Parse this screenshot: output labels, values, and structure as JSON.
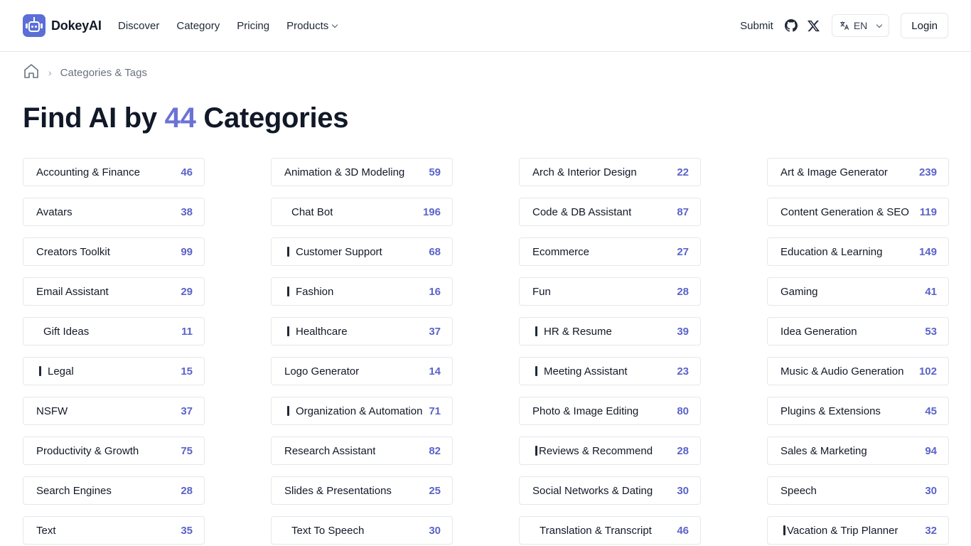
{
  "brand": {
    "name": "DokeyAI"
  },
  "nav": [
    {
      "label": "Discover"
    },
    {
      "label": "Category"
    },
    {
      "label": "Pricing"
    },
    {
      "label": "Products"
    }
  ],
  "header_right": {
    "submit": "Submit",
    "language": "EN",
    "login": "Login"
  },
  "breadcrumb": {
    "current": "Categories & Tags"
  },
  "title": {
    "prefix": "Find AI by",
    "count": "44",
    "suffix": "Categories"
  },
  "colors": {
    "accent": "#5b63c9",
    "brand": "#5b6fd6"
  },
  "categories": [
    {
      "name": "Accounting & Finance",
      "count": "46",
      "prefix": ""
    },
    {
      "name": "Animation & 3D Modeling",
      "count": "59",
      "prefix": ""
    },
    {
      "name": "Arch & Interior Design",
      "count": "22",
      "prefix": ""
    },
    {
      "name": "Art & Image Generator",
      "count": "239",
      "prefix": ""
    },
    {
      "name": "Avatars",
      "count": "38",
      "prefix": ""
    },
    {
      "name": "Chat Bot",
      "count": "196",
      "prefix": "space"
    },
    {
      "name": "Code & DB Assistant",
      "count": "87",
      "prefix": ""
    },
    {
      "name": "Content Generation & SEO",
      "count": "119",
      "prefix": ""
    },
    {
      "name": "Creators Toolkit",
      "count": "99",
      "prefix": ""
    },
    {
      "name": "Customer Support",
      "count": "68",
      "prefix": "emoji"
    },
    {
      "name": "Ecommerce",
      "count": "27",
      "prefix": ""
    },
    {
      "name": "Education & Learning",
      "count": "149",
      "prefix": ""
    },
    {
      "name": "Email Assistant",
      "count": "29",
      "prefix": ""
    },
    {
      "name": "Fashion",
      "count": "16",
      "prefix": "emoji"
    },
    {
      "name": "Fun",
      "count": "28",
      "prefix": ""
    },
    {
      "name": "Gaming",
      "count": "41",
      "prefix": ""
    },
    {
      "name": "Gift Ideas",
      "count": "11",
      "prefix": "space"
    },
    {
      "name": "Healthcare",
      "count": "37",
      "prefix": "emoji"
    },
    {
      "name": "HR & Resume",
      "count": "39",
      "prefix": "emoji"
    },
    {
      "name": "Idea Generation",
      "count": "53",
      "prefix": ""
    },
    {
      "name": "Legal",
      "count": "15",
      "prefix": "emoji"
    },
    {
      "name": "Logo Generator",
      "count": "14",
      "prefix": ""
    },
    {
      "name": "Meeting Assistant",
      "count": "23",
      "prefix": "emoji"
    },
    {
      "name": "Music & Audio Generation",
      "count": "102",
      "prefix": ""
    },
    {
      "name": "NSFW",
      "count": "37",
      "prefix": ""
    },
    {
      "name": "Organization & Automation",
      "count": "71",
      "prefix": "emoji"
    },
    {
      "name": "Photo & Image Editing",
      "count": "80",
      "prefix": ""
    },
    {
      "name": "Plugins & Extensions",
      "count": "45",
      "prefix": ""
    },
    {
      "name": "Productivity & Growth",
      "count": "75",
      "prefix": ""
    },
    {
      "name": "Research Assistant",
      "count": "82",
      "prefix": ""
    },
    {
      "name": "Reviews & Recommend",
      "count": "28",
      "prefix": "emoji1"
    },
    {
      "name": "Sales & Marketing",
      "count": "94",
      "prefix": ""
    },
    {
      "name": "Search Engines",
      "count": "28",
      "prefix": ""
    },
    {
      "name": "Slides & Presentations",
      "count": "25",
      "prefix": ""
    },
    {
      "name": "Social Networks & Dating",
      "count": "30",
      "prefix": ""
    },
    {
      "name": "Speech",
      "count": "30",
      "prefix": ""
    },
    {
      "name": "Text",
      "count": "35",
      "prefix": ""
    },
    {
      "name": "Text To Speech",
      "count": "30",
      "prefix": "space"
    },
    {
      "name": "Translation & Transcript",
      "count": "46",
      "prefix": "space"
    },
    {
      "name": "Vacation & Trip Planner",
      "count": "32",
      "prefix": "emoji1"
    }
  ]
}
